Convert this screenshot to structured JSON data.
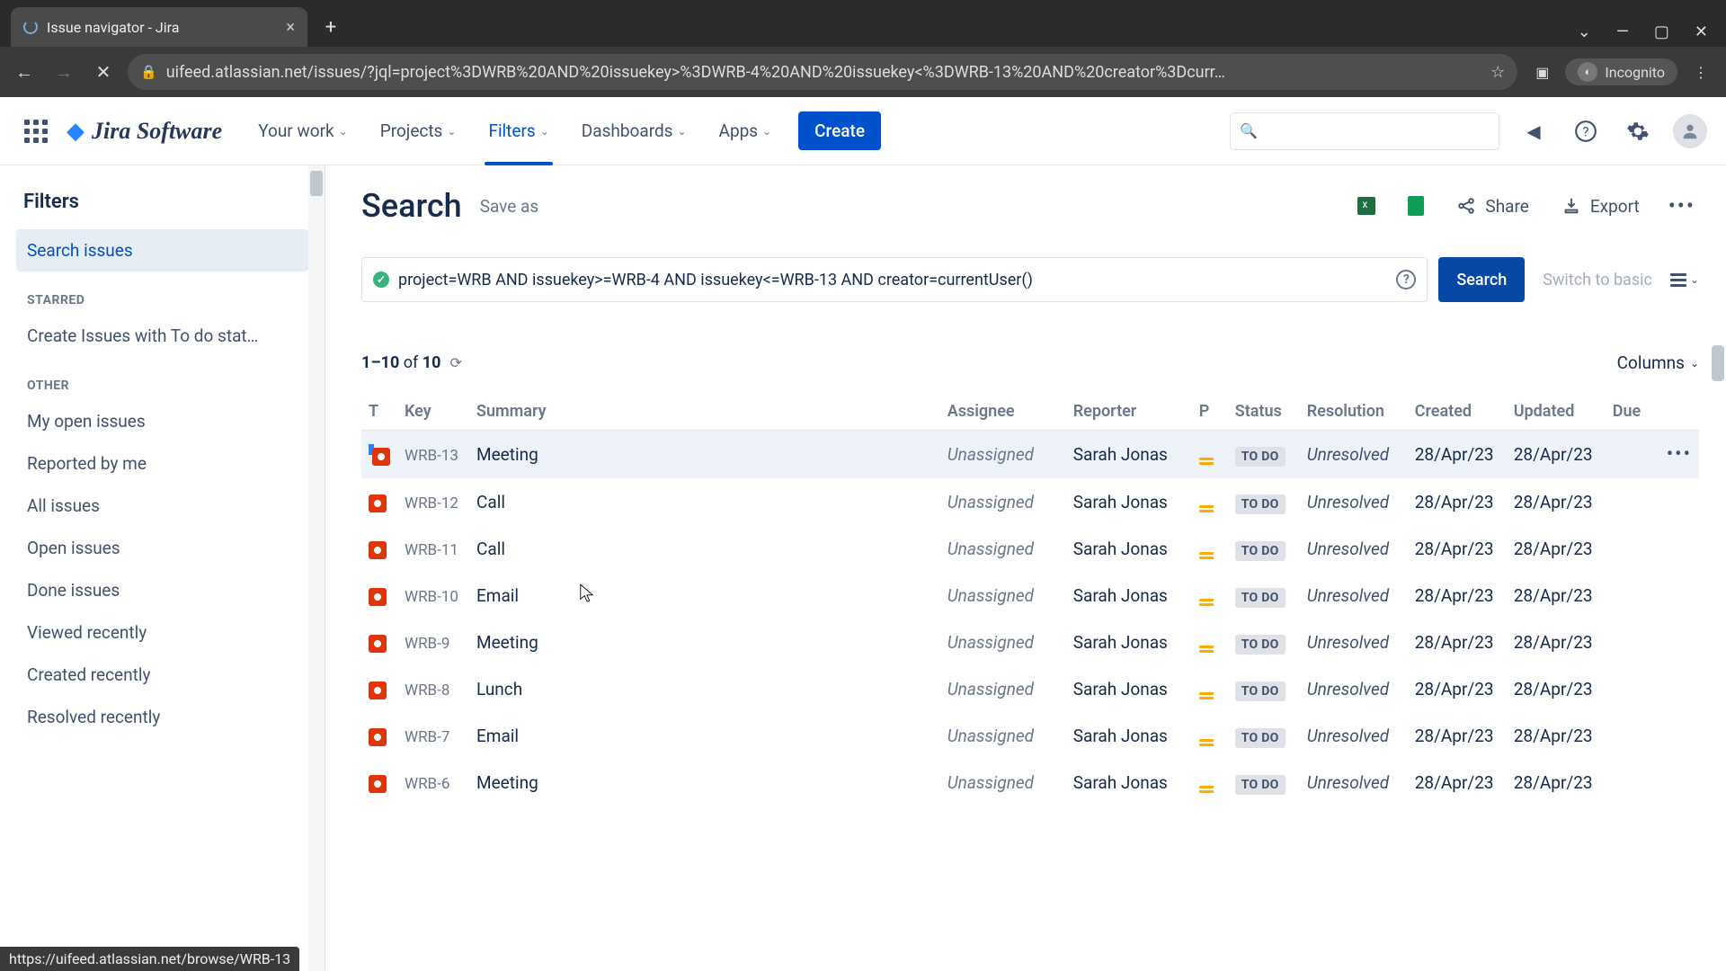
{
  "browser": {
    "tab_title": "Issue navigator - Jira",
    "url": "uifeed.atlassian.net/issues/?jql=project%3DWRB%20AND%20issuekey>%3DWRB-4%20AND%20issuekey<%3DWRB-13%20AND%20creator%3Dcurr…",
    "incognito_label": "Incognito",
    "status_url": "https://uifeed.atlassian.net/browse/WRB-13"
  },
  "topnav": {
    "product": "Jira Software",
    "items": [
      {
        "label": "Your work"
      },
      {
        "label": "Projects"
      },
      {
        "label": "Filters",
        "active": true
      },
      {
        "label": "Dashboards"
      },
      {
        "label": "Apps"
      }
    ],
    "create": "Create"
  },
  "sidebar": {
    "heading": "Filters",
    "search_issues": "Search issues",
    "starred_label": "STARRED",
    "starred_items": [
      "Create Issues with To do stat…"
    ],
    "other_label": "OTHER",
    "other_items": [
      "My open issues",
      "Reported by me",
      "All issues",
      "Open issues",
      "Done issues",
      "Viewed recently",
      "Created recently",
      "Resolved recently"
    ]
  },
  "page": {
    "title": "Search",
    "saveas": "Save as",
    "share": "Share",
    "export": "Export",
    "jql": "project=WRB AND issuekey>=WRB-4 AND issuekey<=WRB-13 AND creator=currentUser()",
    "search_btn": "Search",
    "switch_basic": "Switch to basic",
    "count_html_prefix": "1–10",
    "count_of": " of ",
    "count_total": "10",
    "columns_btn": "Columns"
  },
  "table": {
    "headers": {
      "type": "T",
      "key": "Key",
      "summary": "Summary",
      "assignee": "Assignee",
      "reporter": "Reporter",
      "priority": "P",
      "status": "Status",
      "resolution": "Resolution",
      "created": "Created",
      "updated": "Updated",
      "due": "Due"
    },
    "rows": [
      {
        "key": "WRB-13",
        "summary": "Meeting",
        "assignee": "Unassigned",
        "reporter": "Sarah Jonas",
        "status": "TO DO",
        "resolution": "Unresolved",
        "created": "28/Apr/23",
        "updated": "28/Apr/23",
        "hover": true,
        "indicator": true
      },
      {
        "key": "WRB-12",
        "summary": "Call",
        "assignee": "Unassigned",
        "reporter": "Sarah Jonas",
        "status": "TO DO",
        "resolution": "Unresolved",
        "created": "28/Apr/23",
        "updated": "28/Apr/23"
      },
      {
        "key": "WRB-11",
        "summary": "Call",
        "assignee": "Unassigned",
        "reporter": "Sarah Jonas",
        "status": "TO DO",
        "resolution": "Unresolved",
        "created": "28/Apr/23",
        "updated": "28/Apr/23"
      },
      {
        "key": "WRB-10",
        "summary": "Email",
        "assignee": "Unassigned",
        "reporter": "Sarah Jonas",
        "status": "TO DO",
        "resolution": "Unresolved",
        "created": "28/Apr/23",
        "updated": "28/Apr/23"
      },
      {
        "key": "WRB-9",
        "summary": "Meeting",
        "assignee": "Unassigned",
        "reporter": "Sarah Jonas",
        "status": "TO DO",
        "resolution": "Unresolved",
        "created": "28/Apr/23",
        "updated": "28/Apr/23"
      },
      {
        "key": "WRB-8",
        "summary": "Lunch",
        "assignee": "Unassigned",
        "reporter": "Sarah Jonas",
        "status": "TO DO",
        "resolution": "Unresolved",
        "created": "28/Apr/23",
        "updated": "28/Apr/23"
      },
      {
        "key": "WRB-7",
        "summary": "Email",
        "assignee": "Unassigned",
        "reporter": "Sarah Jonas",
        "status": "TO DO",
        "resolution": "Unresolved",
        "created": "28/Apr/23",
        "updated": "28/Apr/23"
      },
      {
        "key": "WRB-6",
        "summary": "Meeting",
        "assignee": "Unassigned",
        "reporter": "Sarah Jonas",
        "status": "TO DO",
        "resolution": "Unresolved",
        "created": "28/Apr/23",
        "updated": "28/Apr/23"
      }
    ]
  }
}
